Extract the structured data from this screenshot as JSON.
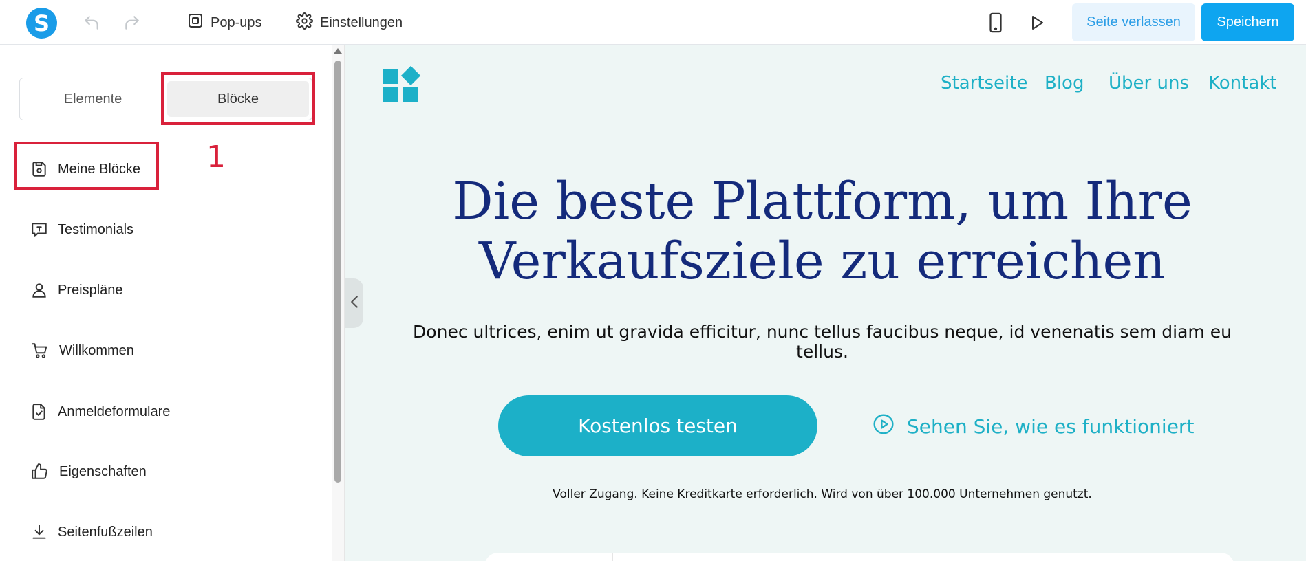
{
  "topbar": {
    "logo_letter": "S",
    "popups_label": "Pop-ups",
    "settings_label": "Einstellungen",
    "leave_label": "Seite verlassen",
    "save_label": "Speichern"
  },
  "sidebar": {
    "tabs": {
      "elements": "Elemente",
      "blocks": "Blöcke",
      "active": "blocks"
    },
    "annotation_number": "1",
    "items": [
      {
        "label": "Meine Blöcke",
        "icon": "save-icon"
      },
      {
        "label": "Testimonials",
        "icon": "speech-bubble-icon"
      },
      {
        "label": "Preispläne",
        "icon": "user-icon"
      },
      {
        "label": "Willkommen",
        "icon": "cart-icon"
      },
      {
        "label": "Anmeldeformulare",
        "icon": "document-check-icon"
      },
      {
        "label": "Eigenschaften",
        "icon": "thumbs-up-icon"
      },
      {
        "label": "Seitenfußzeilen",
        "icon": "download-icon"
      }
    ]
  },
  "canvas": {
    "nav": [
      "Startseite",
      "Blog",
      "Über uns",
      "Kontakt"
    ],
    "headline_line1": "Die beste Plattform, um Ihre",
    "headline_line2": "Verkaufsziele zu erreichen",
    "subtext": "Donec ultrices, enim ut gravida efficitur, nunc tellus faucibus neque, id venenatis sem diam eu tellus.",
    "cta_label": "Kostenlos testen",
    "watch_label": "Sehen Sie, wie es funktioniert",
    "fineprint": "Voller Zugang. Keine Kreditkarte erforderlich. Wird von über 100.000 Unternehmen genutzt."
  },
  "colors": {
    "accent": "#1cb0c8",
    "headline": "#142a7b",
    "primary_button": "#0ea5f0",
    "annotation": "#d9213b",
    "canvas_bg": "#eef6f5"
  }
}
